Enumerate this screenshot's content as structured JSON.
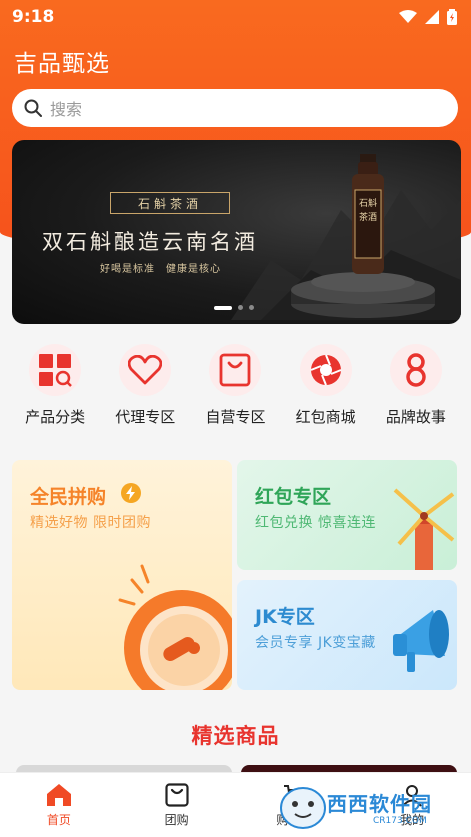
{
  "status_bar": {
    "time": "9:18"
  },
  "header": {
    "title": "吉品甄选"
  },
  "search": {
    "placeholder": "搜索"
  },
  "banner": {
    "seal_text": "石斛茶酒",
    "headline": "双石斛酿造云南名酒",
    "subline": "好喝是标准　健康是核心",
    "bottle_label": "石斛茶酒"
  },
  "categories": [
    {
      "label": "产品分类",
      "icon": "category-icon"
    },
    {
      "label": "代理专区",
      "icon": "heart-icon"
    },
    {
      "label": "自营专区",
      "icon": "shopping-bag-icon"
    },
    {
      "label": "红包商城",
      "icon": "aperture-icon"
    },
    {
      "label": "品牌故事",
      "icon": "brand-icon"
    }
  ],
  "promos": {
    "group_buy": {
      "title": "全民拼购",
      "subtitle": "精选好物 限时团购"
    },
    "red_packet": {
      "title": "红包专区",
      "subtitle": "红包兑换 惊喜连连"
    },
    "jk": {
      "title": "JK专区",
      "subtitle": "会员专享 JK变宝藏"
    }
  },
  "section": {
    "title": "精选商品"
  },
  "tabbar": [
    {
      "label": "首页",
      "icon": "home-icon",
      "active": true
    },
    {
      "label": "团购",
      "icon": "shopping-bag-icon",
      "active": false
    },
    {
      "label": "购物车",
      "icon": "cart-icon",
      "active": false
    },
    {
      "label": "我的",
      "icon": "user-icon",
      "active": false
    }
  ],
  "watermark": {
    "text": "西西软件园",
    "url": "CR173.COM"
  },
  "colors": {
    "primary": "#f6521c",
    "accent_red": "#e8342e",
    "category_icon": "#e8342e"
  }
}
